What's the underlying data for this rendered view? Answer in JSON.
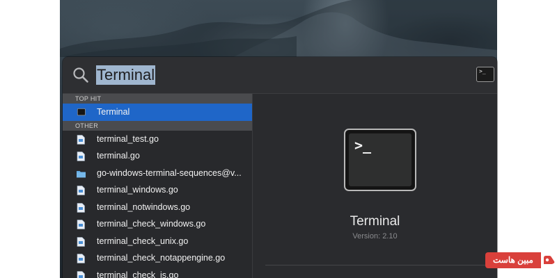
{
  "search": {
    "query": "Terminal"
  },
  "results": {
    "top_hit_header": "TOP HIT",
    "top_hit": {
      "label": "Terminal",
      "icon": "terminal-app-icon"
    },
    "other_header": "OTHER",
    "items": [
      {
        "label": "terminal_test.go",
        "icon": "document-icon"
      },
      {
        "label": "terminal.go",
        "icon": "document-icon"
      },
      {
        "label": "go-windows-terminal-sequences@v...",
        "icon": "folder-icon"
      },
      {
        "label": "terminal_windows.go",
        "icon": "document-icon"
      },
      {
        "label": "terminal_notwindows.go",
        "icon": "document-icon"
      },
      {
        "label": "terminal_check_windows.go",
        "icon": "document-icon"
      },
      {
        "label": "terminal_check_unix.go",
        "icon": "document-icon"
      },
      {
        "label": "terminal_check_notappengine.go",
        "icon": "document-icon"
      },
      {
        "label": "terminal_check_js.go",
        "icon": "document-icon"
      }
    ]
  },
  "preview": {
    "app_icon_prompt": ">_",
    "app_name": "Terminal",
    "version": "Version: 2.10"
  },
  "watermark": {
    "text": "مبین هاست"
  },
  "colors": {
    "selection": "#1f66c8",
    "panel": "#2a2b2e",
    "watermark": "#d9403b"
  }
}
